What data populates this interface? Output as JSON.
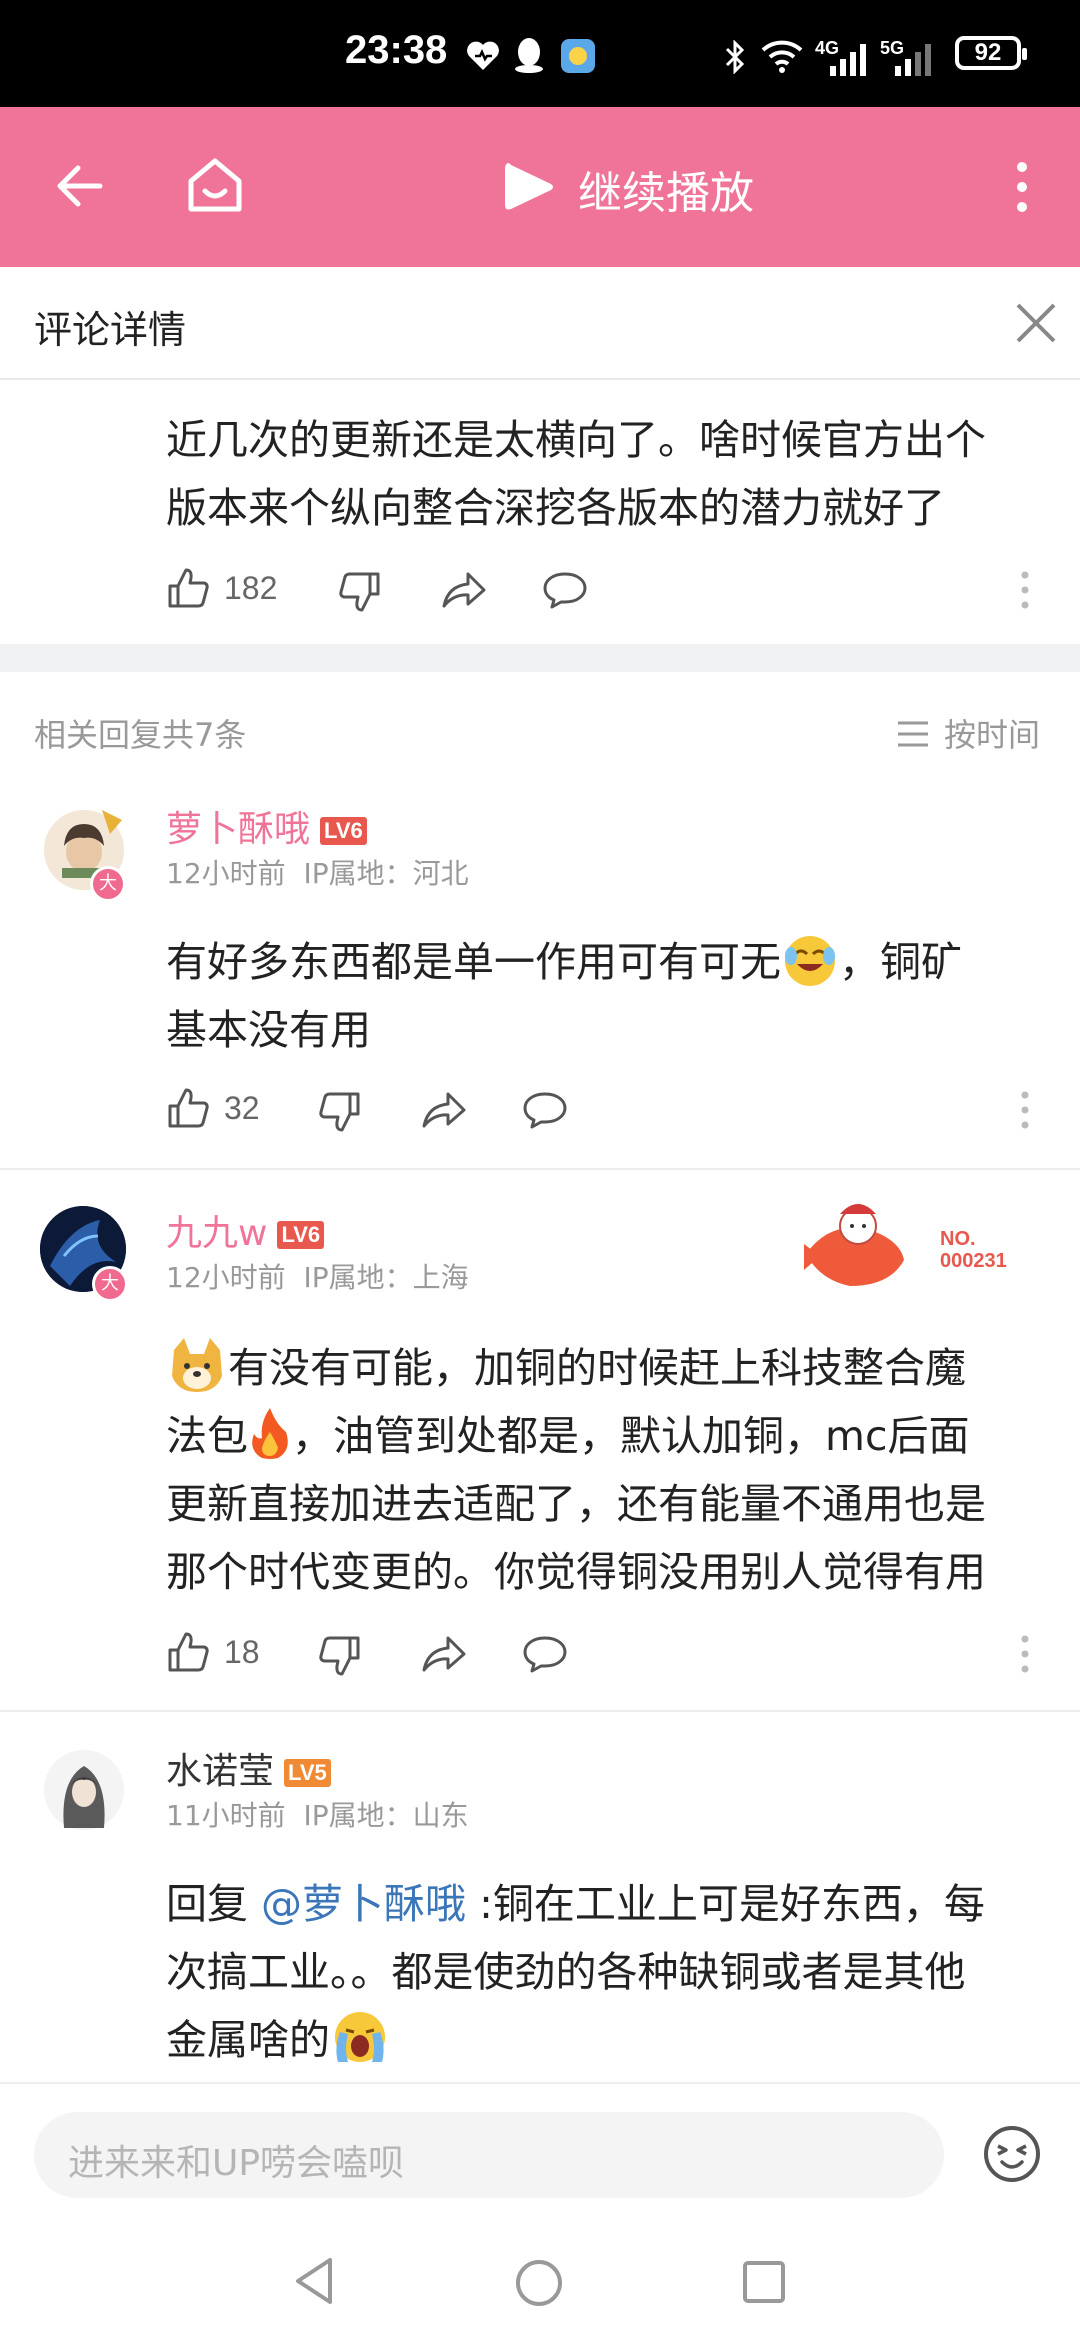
{
  "status_bar": {
    "time": "23:38",
    "network1": "4G",
    "network2": "5G",
    "battery": "92"
  },
  "header": {
    "continue_label": "继续播放"
  },
  "detail": {
    "title": "评论详情"
  },
  "main_comment": {
    "text_line1": "近几次的更新还是太横向了。啥时候官方出个",
    "text_line2": "版本来个纵向整合深挖各版本的潜力就好了",
    "likes": "182"
  },
  "replies_header": {
    "count_label": "相关回复共7条",
    "sort_label": "按时间"
  },
  "replies": [
    {
      "username": "萝卜酥哦",
      "level": "LV6",
      "time": "12小时前",
      "ip": "IP属地：河北",
      "line1": "有好多东西都是单一作用可有可无",
      "line1_tail": "，铜矿",
      "line2": "基本没有用",
      "likes": "32",
      "avatar_badge": "大"
    },
    {
      "username": "九九w",
      "level": "LV6",
      "time": "12小时前",
      "ip": "IP属地：上海",
      "fan_no_label": "NO.",
      "fan_no_value": "000231",
      "line1": "有没有可能，加铜的时候赶上科技整合魔",
      "line2a": "法包",
      "line2b": "，油管到处都是，默认加铜，mc后面",
      "line3": "更新直接加进去适配了，还有能量不通用也是",
      "line4": "那个时代变更的。你觉得铜没用别人觉得有用",
      "likes": "18",
      "avatar_badge": "大"
    },
    {
      "username": "水诺莹",
      "level": "LV5",
      "time": "11小时前",
      "ip": "IP属地：山东",
      "reply_prefix": "回复 ",
      "mention": "@萝卜酥哦",
      "line1_rest": " :铜在工业上可是好东西，每",
      "line2": "次搞工业。。都是使劲的各种缺铜或者是其他",
      "line3": "金属啥的"
    }
  ],
  "input": {
    "placeholder": "进来来和UP唠会嗑呗"
  },
  "colors": {
    "brand_pink": "#ef7498",
    "link_blue": "#3a76b8",
    "lv6": "#e8584e",
    "lv5": "#f08a34"
  }
}
